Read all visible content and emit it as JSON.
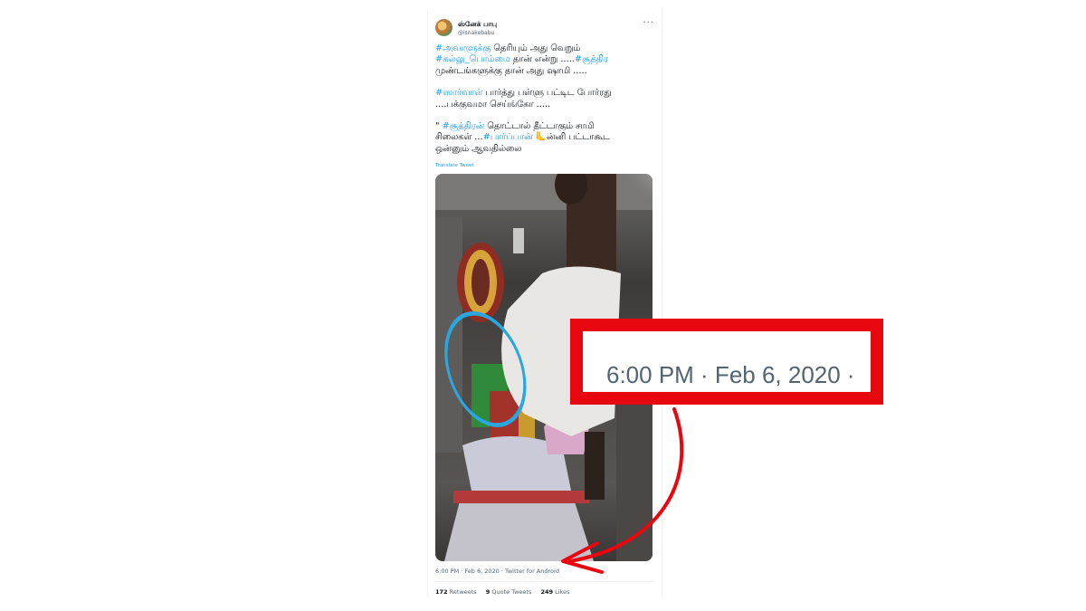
{
  "tweet": {
    "display_name": "ஸ்னேக் பாபு",
    "handle": "@isnakebabu",
    "more": "···",
    "translate": "Translate Tweet",
    "meta": "6:00 PM · Feb 6, 2020 · Twitter for Android",
    "stats": {
      "retweets_count": "172",
      "retweets_label": "Retweets",
      "quotes_count": "9",
      "quotes_label": "Quote Tweets",
      "likes_count": "249",
      "likes_label": "Likes"
    },
    "p1": {
      "t1": "#அவாளுக்கு",
      "s1": " தெரியும் அது வெறும்\n",
      "t2": "#கல்லு_பொம்மை",
      "s2": " தான் என்று .....",
      "t3": "#சூத்திர",
      "s3": "\nமுண்டங்களுக்கு தான் அது ஷாமி  ....."
    },
    "p2": {
      "t1": "#ஸார்வாள்",
      "s1": " பார்த்து பள்ளு பட்டிட போர்ரது\n....பக்குவமா செய்ங்கோ ....."
    },
    "p3": {
      "s0": "\" ",
      "t1": "#சூத்திரன்",
      "s1": " தொட்டால் தீட்டாகும் சாமி\nசிலைகள் ...",
      "t2": "#பார்ப்பான்",
      "s2": " 🦶ன்னி பட்டாகூட\nஒன்னும் ஆவதில்லை"
    }
  },
  "zoom": {
    "text": "6:00 PM · Feb 6, 2020 ·"
  },
  "colors": {
    "highlight_red": "#e8060f",
    "circle_blue": "#2aa6e0",
    "link_blue": "#1d9bf0"
  }
}
